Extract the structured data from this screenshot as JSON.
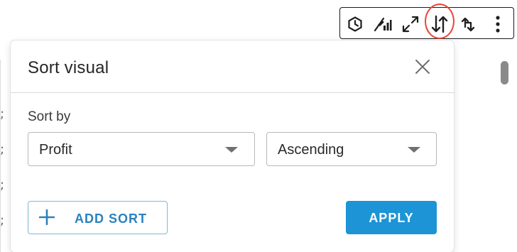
{
  "toolbar": {
    "tools": [
      {
        "name": "hexagon-icon"
      },
      {
        "name": "chart-settings-icon"
      },
      {
        "name": "expand-icon"
      },
      {
        "name": "sort-icon",
        "highlighted": true
      },
      {
        "name": "drill-icon"
      },
      {
        "name": "more-options-icon"
      }
    ],
    "highlight_color": "#e8453c"
  },
  "dialog": {
    "title": "Sort visual",
    "sort_by_label": "Sort by",
    "field_select": {
      "value": "Profit"
    },
    "order_select": {
      "value": "Ascending"
    },
    "add_sort_label": "ADD SORT",
    "apply_label": "APPLY"
  },
  "colors": {
    "primary": "#1c94d6",
    "link": "#2a82bd",
    "add_sort_border": "#7fb6da"
  }
}
